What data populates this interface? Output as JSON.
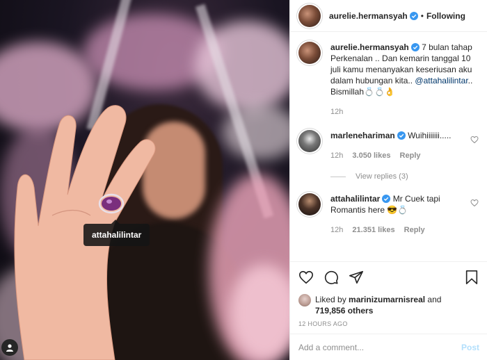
{
  "header": {
    "username": "aurelie.hermansyah",
    "dot": "•",
    "follow_label": "Following"
  },
  "photo": {
    "tag_label": "attahalilintar"
  },
  "caption": {
    "username": "aurelie.hermansyah",
    "text": "7 bulan tahap Perkenalan .. Dan kemarin tanggal 10 juli kamu menanyakan keseriusan aku dalam hubungan kita.. ",
    "mention": "@attahalilintar",
    "text_after": ".. Bismillah💍💍👌",
    "time": "12h"
  },
  "comments": [
    {
      "username": "marlenehariman",
      "text": "Wuihiiiiiii.....",
      "time": "12h",
      "likes": "3.050 likes",
      "reply_label": "Reply",
      "view_replies": "View replies (3)"
    },
    {
      "username": "attahalilintar",
      "text": "Mr Cuek tapi Romantis here 😎💍",
      "time": "12h",
      "likes": "21.351 likes",
      "reply_label": "Reply"
    }
  ],
  "likes": {
    "liked_by_prefix": "Liked by ",
    "liked_by_user": "marinizumarnisreal",
    "liked_by_mid": " and",
    "count": "719,856 others"
  },
  "post_age": "12 HOURS AGO",
  "add_comment": {
    "placeholder": "Add a comment...",
    "post_label": "Post"
  },
  "colors": {
    "verified": "#3897f0",
    "mention": "#00376b",
    "post_disabled": "#b2dffc",
    "muted": "#8e8e8e"
  },
  "icons": [
    "verified-icon",
    "heart-icon",
    "comment-icon",
    "share-icon",
    "bookmark-icon",
    "tagged-user-icon"
  ]
}
